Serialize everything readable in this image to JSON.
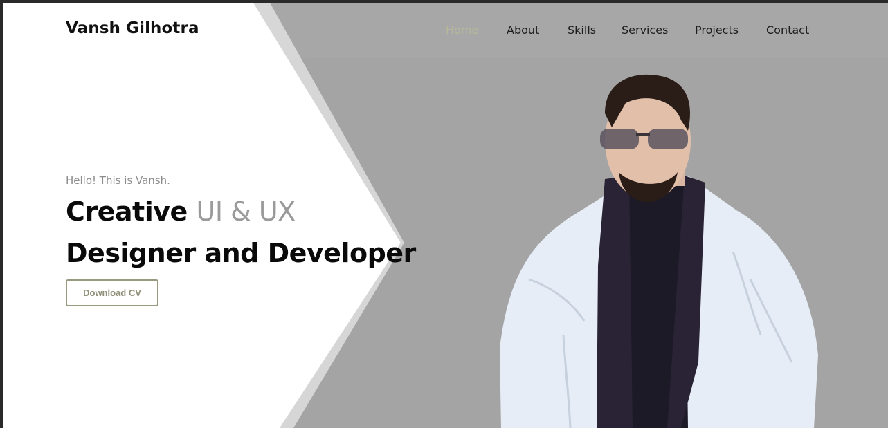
{
  "header": {
    "brand": "Vansh Gilhotra",
    "nav": [
      {
        "label": "Home",
        "active": true
      },
      {
        "label": "About",
        "active": false
      },
      {
        "label": "Skills",
        "active": false
      },
      {
        "label": "Services",
        "active": false
      },
      {
        "label": "Projects",
        "active": false
      },
      {
        "label": "Contact",
        "active": false
      }
    ]
  },
  "hero": {
    "greeting": "Hello! This is Vansh.",
    "headline_line1_bold": "Creative",
    "headline_line1_muted": "UI & UX",
    "headline_line2": "Designer and Developer",
    "cv_button": "Download CV"
  },
  "colors": {
    "background_gray": "#a4a4a4",
    "panel_white": "#ffffff",
    "accent_olive": "#b7b89a",
    "text_dark": "#0a0a0a"
  }
}
